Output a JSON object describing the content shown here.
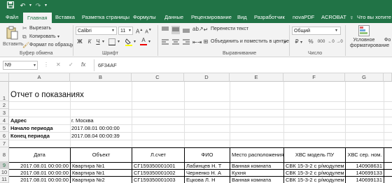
{
  "quick_access": {
    "save_icon": "save-icon",
    "undo_icon": "undo-icon",
    "redo_icon": "redo-icon",
    "customize_icon": "customize-icon"
  },
  "tabs": [
    "Файл",
    "Главная",
    "Вставка",
    "Разметка страницы",
    "Формулы",
    "Данные",
    "Рецензирование",
    "Вид",
    "Разработчик",
    "novaPDF",
    "ACROBAT"
  ],
  "tell_me": "Что вы хотите с",
  "ribbon": {
    "paste": "Вставить",
    "cut": "Вырезать",
    "copy": "Копировать",
    "format_painter": "Формат по образцу",
    "clipboard_group": "Буфер обмена",
    "font_name": "Calibri",
    "font_size": "11",
    "bold": "Ж",
    "italic": "К",
    "underline": "Ч",
    "font_group": "Шрифт",
    "wrap_text": "Перенести текст",
    "merge_center": "Объединить и поместить в центре",
    "alignment_group": "Выравнивание",
    "number_format": "Общий",
    "percent": "%",
    "thousands": "000",
    "number_group": "Число",
    "conditional_formatting": "Условное форматирование",
    "format_as_table": "Фо"
  },
  "formula_bar": {
    "name_box": "N9",
    "fx": "fx",
    "value": "6F34AF"
  },
  "columns": [
    "A",
    "B",
    "C",
    "D",
    "E",
    "F",
    "G"
  ],
  "rows": [
    "1",
    "2",
    "3",
    "4",
    "5",
    "6",
    "7",
    "8",
    "9",
    "10",
    "11"
  ],
  "sheet": {
    "title": "Отчет о показаниях",
    "address_label": "Адрес",
    "address_value": "г. Москва",
    "start_label": "Начало периода",
    "start_value": "2017.08.01 00:00:00",
    "end_label": "Конец периода",
    "end_value": "2017.08.04 00:00:39",
    "headers": [
      "Дата",
      "Объект",
      "Л.счет",
      "ФИО",
      "Место расположения",
      "ХВС модель ПУ",
      "ХВС сер. ном."
    ],
    "data": [
      [
        "2017.08.01 00:00:00",
        "Квартира №1",
        "СГ159350001001",
        "Лабинцев Н. Т",
        "Ванная комната",
        "СВК 15-3-2 с р/модулем",
        "140908631"
      ],
      [
        "2017.08.01 00:00:00",
        "Квартира №1",
        "СГ159350001002",
        "Черненко Н. А",
        "Кухня",
        "СВК 15-3-2 с р/модулем",
        "140699133"
      ],
      [
        "2017.08.01 00:00:00",
        "Квартира №2",
        "СГ159350001003",
        "Ецкова Л. Н",
        "Ванная комната",
        "СВК 15-3-2 с р/модулем",
        "140699131"
      ]
    ]
  },
  "colors": {
    "accent": "#217346",
    "ribbon": "#f3f3f3",
    "gridline": "#e1e1e1"
  }
}
